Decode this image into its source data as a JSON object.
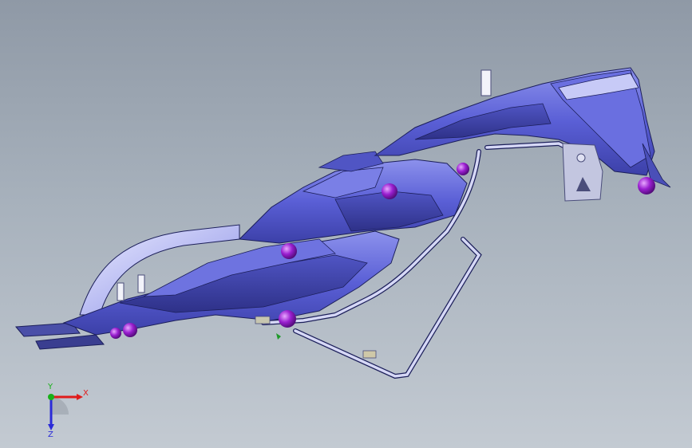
{
  "viewport": {
    "background_top": "#8f99a6",
    "background_bottom": "#c3cad2"
  },
  "model": {
    "body_color": "#5a5fd6",
    "body_dark": "#3a3e9e",
    "body_light": "#9ea3f0",
    "edge_color": "#1c1f5a",
    "marker_color": "#9a1fd0",
    "tube_color": "#d6d8f6",
    "bracket_color": "#b9bddb"
  },
  "triad": {
    "x_label": "X",
    "y_label": "Y",
    "z_label": "Z",
    "x_color": "#e01b1b",
    "y_color": "#18b018",
    "z_color": "#2b2bd8"
  }
}
